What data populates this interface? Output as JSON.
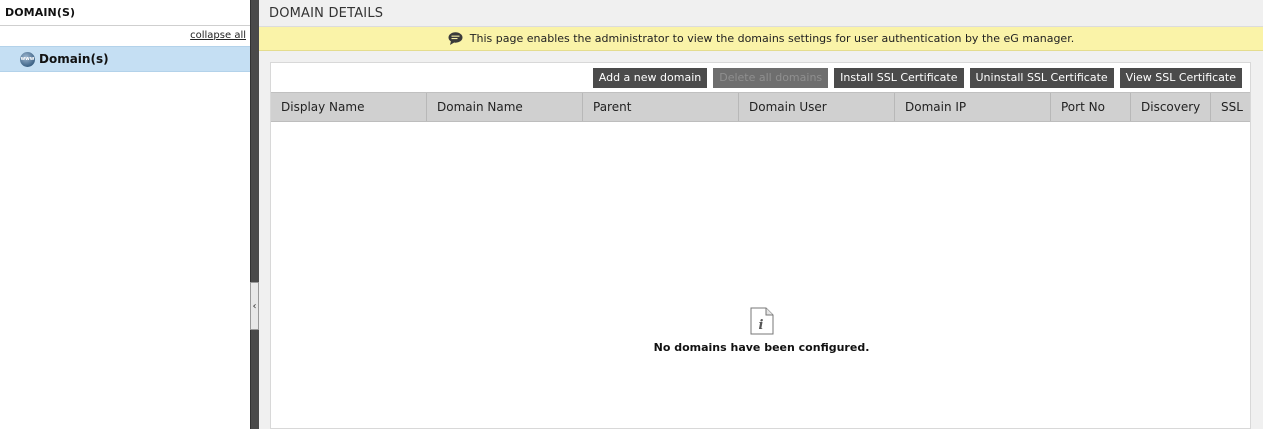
{
  "left": {
    "title": "DOMAIN(S)",
    "collapse_label": "collapse all",
    "tree": [
      {
        "label": "Domain(s)",
        "icon": "www-globe-icon"
      }
    ]
  },
  "main": {
    "title": "DOMAIN DETAILS",
    "info_message": "This page enables the administrator to view the domains settings for user authentication by the eG manager.",
    "toolbar": {
      "add": "Add a new domain",
      "delete_all": "Delete all domains",
      "install_ssl": "Install SSL Certificate",
      "uninstall_ssl": "Uninstall SSL Certificate",
      "view_ssl": "View SSL Certificate"
    },
    "columns": [
      "Display Name",
      "Domain Name",
      "Parent",
      "Domain User",
      "Domain IP",
      "Port No",
      "Discovery",
      "SSL"
    ],
    "empty_message": "No domains have been configured."
  },
  "colors": {
    "accent_selected": "#c5dff3",
    "info_bar": "#faf3a8",
    "button": "#4b4b4b"
  }
}
